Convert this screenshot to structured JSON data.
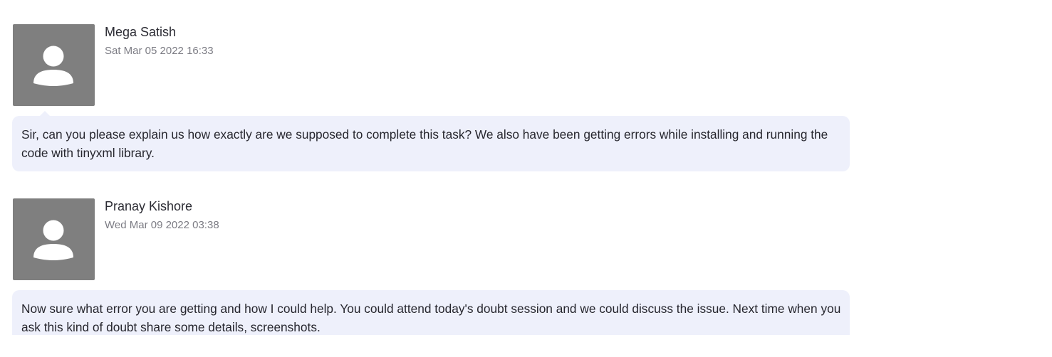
{
  "comments": [
    {
      "author": "Mega Satish",
      "timestamp": "Sat Mar 05 2022 16:33",
      "avatar_icon": "default-user-avatar-icon",
      "message": "Sir, can you please explain us how exactly are we supposed to complete this task? We also have been getting errors while installing and running the code with tinyxml library."
    },
    {
      "author": "Pranay Kishore",
      "timestamp": "Wed Mar 09 2022 03:38",
      "avatar_icon": "default-user-avatar-icon",
      "message": "Now sure what error you are getting and how I could help. You could attend today's doubt session and we could discuss the issue. Next time when you ask this kind of doubt share some details, screenshots."
    }
  ],
  "colors": {
    "avatar_background": "#7f7f7f",
    "bubble_background": "#eef0fb",
    "author_text": "#2b2b33",
    "timestamp_text": "#7c7c84"
  }
}
